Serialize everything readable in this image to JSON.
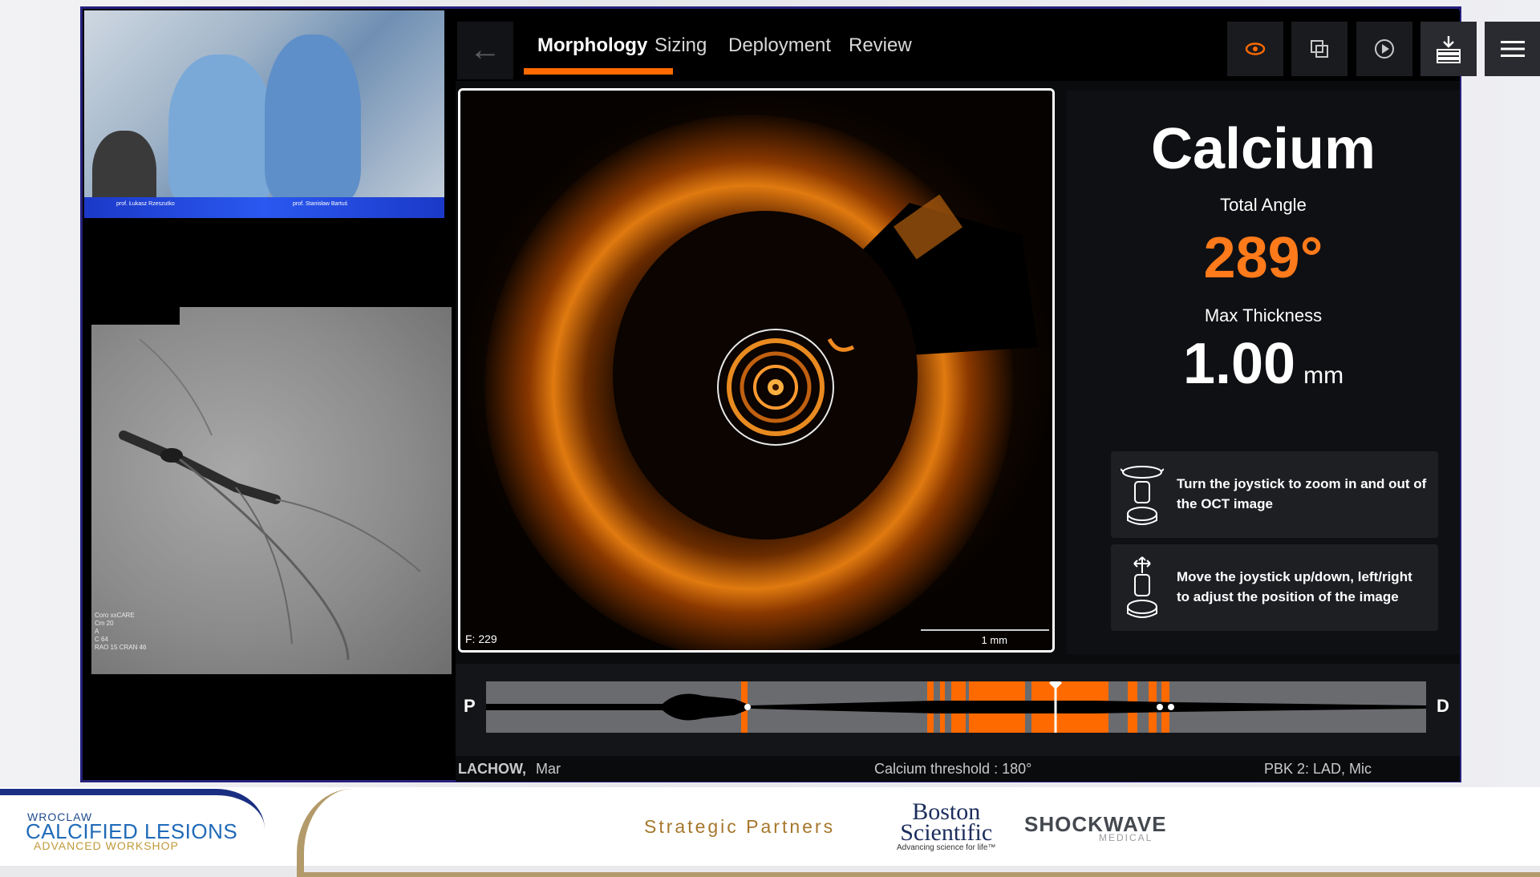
{
  "app": {
    "tabs": [
      {
        "label": "Morphology",
        "active": true
      },
      {
        "label": "Sizing",
        "active": false
      },
      {
        "label": "Deployment",
        "active": false
      },
      {
        "label": "Review",
        "active": false
      }
    ],
    "toolbar_icons": [
      "back-arrow-icon",
      "eye-icon",
      "copy-icon",
      "play-icon",
      "download-stack-icon",
      "menu-icon"
    ],
    "accent_color": "#ff6a00"
  },
  "oct": {
    "frame_label": "F: 229",
    "scale_label": "1 mm"
  },
  "panel": {
    "title": "Calcium",
    "angle_label": "Total Angle",
    "angle_value": "289°",
    "thickness_label": "Max Thickness",
    "thickness_value": "1.00",
    "thickness_unit": "mm",
    "hints": [
      {
        "icon": "joystick-rotate-icon",
        "text": "Turn the joystick to zoom in and out of the OCT image"
      },
      {
        "icon": "joystick-move-icon",
        "text": "Move the joystick up/down, left/right to adjust the position of the image"
      }
    ]
  },
  "pullback": {
    "left_label": "P",
    "right_label": "D"
  },
  "footer": {
    "patient": "LACHOW,",
    "patient_first": "Mar",
    "threshold_label": "Calcium threshold :",
    "threshold_value": "180°",
    "pbk": "PBK 2:  LAD,  Mic"
  },
  "camera": {
    "names": [
      "prof. Łukasz Rzeszutko",
      "prof. Stanisław Bartuś"
    ]
  },
  "angio": {
    "overlay_lines": [
      "Coro xxCARE",
      "Cm 20",
      "A",
      "C 64",
      "RAO 15  CRAN 46"
    ]
  },
  "sponsor": {
    "city": "WROCLAW",
    "event": "CALCIFIED LESIONS",
    "event_sub": "ADVANCED WORKSHOP",
    "partners_label": "Strategic Partners",
    "partner1_line1": "Boston",
    "partner1_line2": "Scientific",
    "partner1_tag": "Advancing science for life™",
    "partner2": "SHOCKWAVE",
    "partner2_sub": "MEDICAL"
  }
}
